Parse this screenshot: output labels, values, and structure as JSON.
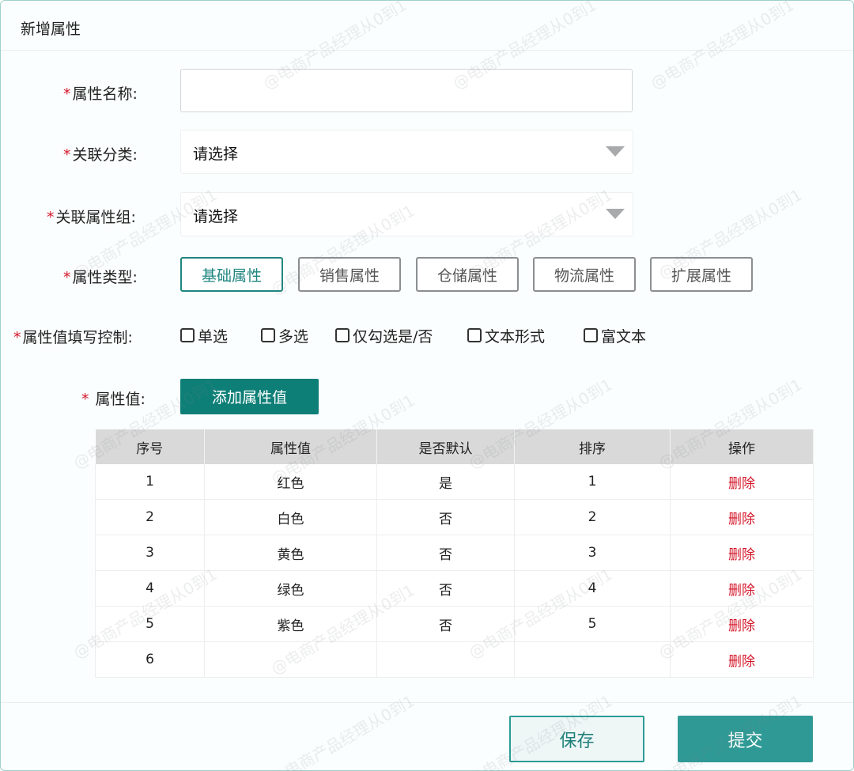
{
  "dialog": {
    "title": "新增属性"
  },
  "form": {
    "name": {
      "required": "*",
      "label": "属性名称:",
      "value": "",
      "placeholder": ""
    },
    "category": {
      "required": "*",
      "label": "关联分类:",
      "value": "请选择"
    },
    "group": {
      "required": "*",
      "label": "关联属性组:",
      "value": "请选择"
    },
    "type": {
      "required": "*",
      "label": "属性类型:",
      "options": [
        "基础属性",
        "销售属性",
        "仓储属性",
        "物流属性",
        "扩展属性"
      ],
      "selected": "基础属性"
    },
    "input_control": {
      "required": "*",
      "label": "属性值填写控制:",
      "options": [
        "单选",
        "多选",
        "仅勾选是/否",
        "文本形式",
        "富文本"
      ]
    },
    "values": {
      "required": "*",
      "label": "属性值:",
      "add_button": "添加属性值"
    }
  },
  "table": {
    "headers": [
      "序号",
      "属性值",
      "是否默认",
      "排序",
      "操作"
    ],
    "rows": [
      {
        "index": "1",
        "value": "红色",
        "default": "是",
        "sort": "1",
        "action": "删除"
      },
      {
        "index": "2",
        "value": "白色",
        "default": "否",
        "sort": "2",
        "action": "删除"
      },
      {
        "index": "3",
        "value": "黄色",
        "default": "否",
        "sort": "3",
        "action": "删除"
      },
      {
        "index": "4",
        "value": "绿色",
        "default": "否",
        "sort": "4",
        "action": "删除"
      },
      {
        "index": "5",
        "value": "紫色",
        "default": "否",
        "sort": "5",
        "action": "删除"
      },
      {
        "index": "6",
        "value": "",
        "default": "",
        "sort": "",
        "action": "删除"
      }
    ]
  },
  "footer": {
    "save": "保存",
    "submit": "提交"
  },
  "watermark": {
    "text": "@电商产品经理从0到1"
  },
  "colors": {
    "accent": "#0e7f77",
    "danger": "#d4172a",
    "header_bg": "#d9d9d9"
  }
}
